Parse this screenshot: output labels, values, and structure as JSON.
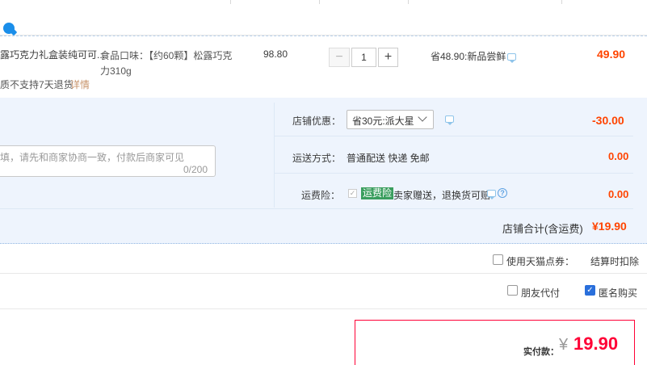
{
  "item": {
    "title": "露巧克力礼盒装纯可可...",
    "sku_line1": "食品口味：【约60颗】松露巧克",
    "sku_line2": "力310g",
    "price": "98.80",
    "return_policy": "质不支持7天退货",
    "return_detail_link": "详情",
    "quantity": "1",
    "minus_glyph": "−",
    "plus_glyph": "+",
    "promo": "省48.90:新品尝鲜",
    "subtotal": "49.90"
  },
  "message": {
    "placeholder": "填，请先和商家协商一致，付款后商家可见",
    "count": "0/200"
  },
  "shop_discount": {
    "label": "店铺优惠：",
    "selected": "省30元:派大星",
    "amount": "-30.00"
  },
  "shipping": {
    "label": "运送方式：",
    "value": "普通配送 快递 免邮",
    "amount": "0.00"
  },
  "insurance": {
    "label": "运费险：",
    "badge": "运费险",
    "text": "卖家赠送，退换货可赔",
    "help_glyph": "?",
    "check_glyph": "✓",
    "amount": "0.00"
  },
  "shop_total": {
    "label": "店铺合计(含运费)",
    "amount": "¥19.90"
  },
  "options": {
    "tmall_points_label": "使用天猫点券：",
    "deduct_text": "结算时扣除",
    "friend_pay_label": "朋友代付",
    "anonymous_label": "匿名购买",
    "anonymous_check": "✓",
    "anonymous_checked": true,
    "friend_pay_checked": false,
    "tmall_points_checked": false
  },
  "payment": {
    "label": "实付款：",
    "currency": "¥",
    "amount": "19.90"
  },
  "colors": {
    "accent_red": "#ff4400",
    "pay_red": "#ff0036",
    "panel_blue": "#eef4fd",
    "insurance_green": "#3a9e5e",
    "check_blue": "#2a6fdb"
  },
  "icons": {
    "wangwang": "wangwang-chat-icon",
    "chat_bubble": "chat-bubble-icon",
    "dropdown": "chevron-down-icon",
    "help": "help-circle-icon"
  }
}
